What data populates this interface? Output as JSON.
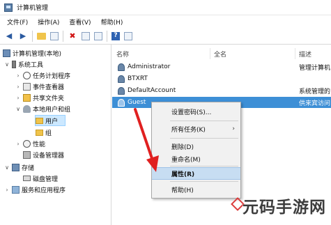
{
  "window": {
    "title": "计算机管理"
  },
  "menubar": [
    "文件(F)",
    "操作(A)",
    "查看(V)",
    "帮助(H)"
  ],
  "toolbar_icons": [
    "back-arrow-icon",
    "forward-arrow-icon",
    "up-folder-icon",
    "properties-icon",
    "delete-icon",
    "list-icon",
    "export-icon",
    "help-icon",
    "console-tree-icon"
  ],
  "tree": [
    {
      "label": "计算机管理(本地)",
      "icon": "computer-icon"
    },
    {
      "label": "系统工具",
      "icon": "tools-icon"
    },
    {
      "label": "任务计划程序",
      "icon": "clock-icon"
    },
    {
      "label": "事件查看器",
      "icon": "event-log-icon"
    },
    {
      "label": "共享文件夹",
      "icon": "shared-folder-icon"
    },
    {
      "label": "本地用户和组",
      "icon": "users-icon"
    },
    {
      "label": "用户",
      "icon": "folder-icon"
    },
    {
      "label": "组",
      "icon": "folder-icon"
    },
    {
      "label": "性能",
      "icon": "performance-icon"
    },
    {
      "label": "设备管理器",
      "icon": "device-manager-icon"
    },
    {
      "label": "存储",
      "icon": "storage-icon"
    },
    {
      "label": "磁盘管理",
      "icon": "disk-icon"
    },
    {
      "label": "服务和应用程序",
      "icon": "services-icon"
    }
  ],
  "list": {
    "headers": {
      "name": "名称",
      "fullname": "全名",
      "desc": "描述"
    },
    "rows": [
      {
        "name": "Administrator",
        "desc": "管理计算机"
      },
      {
        "name": "BTXRT",
        "desc": ""
      },
      {
        "name": "DefaultAccount",
        "desc": "系统管理的"
      },
      {
        "name": "Guest",
        "desc": "供来宾访问"
      }
    ]
  },
  "context_menu": {
    "items": [
      "设置密码(S)...",
      "所有任务(K)",
      "删除(D)",
      "重命名(M)",
      "属性(R)",
      "帮助(H)"
    ]
  },
  "watermark": "元码手游网",
  "colors": {
    "selection": "#3d8fd6",
    "menu_highlight": "#c7ddf2",
    "arrow": "#e02020"
  }
}
